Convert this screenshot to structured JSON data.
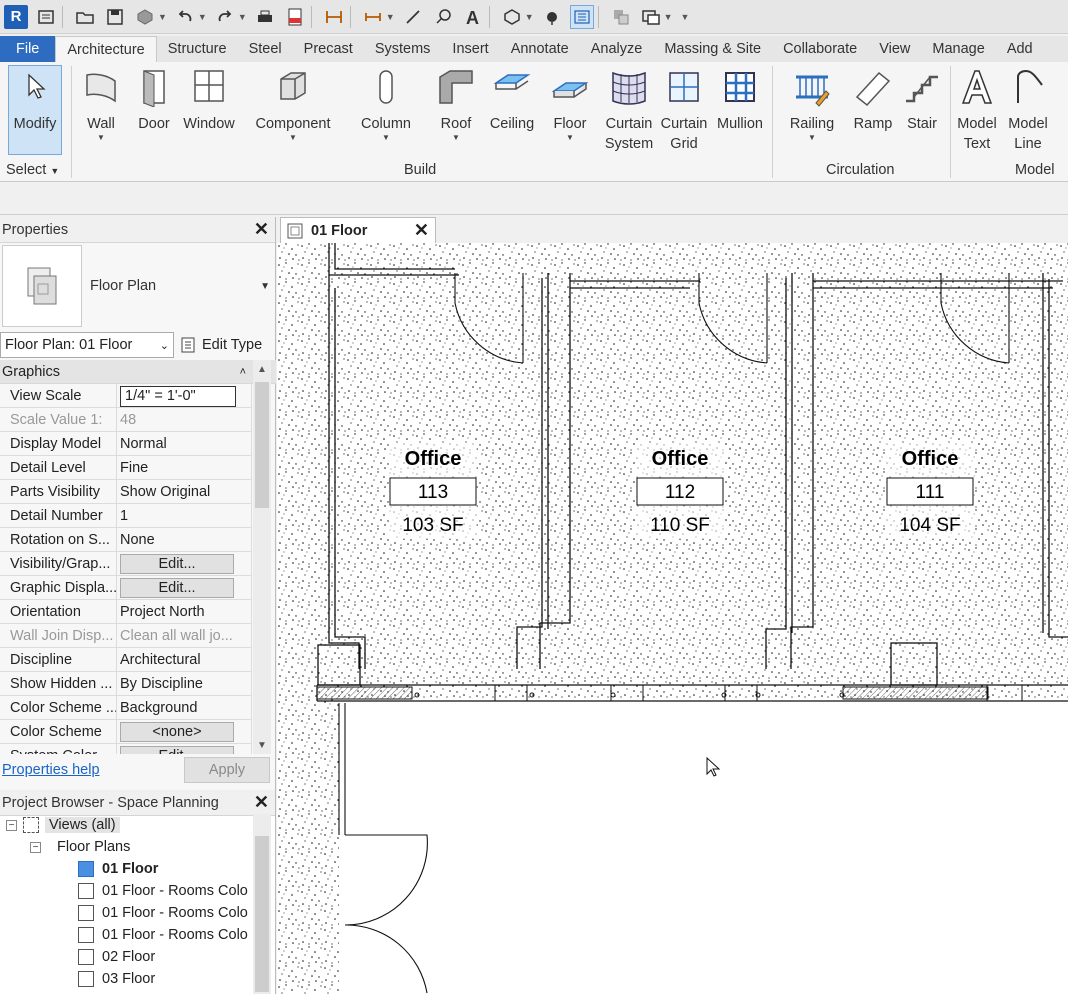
{
  "app": {
    "logo_letter": "R"
  },
  "quick_access": {
    "icons": [
      "home-icon",
      "open-icon",
      "save-icon",
      "sync-icon",
      "undo-icon",
      "redo-icon",
      "print-icon",
      "pdf-icon",
      "measure-icon",
      "dimension-icon",
      "text-icon",
      "3d-view-icon",
      "section-icon",
      "thin-lines-icon",
      "close-hidden-icon",
      "switch-windows-icon"
    ]
  },
  "ribbon_tabs": [
    "File",
    "Architecture",
    "Structure",
    "Steel",
    "Precast",
    "Systems",
    "Insert",
    "Annotate",
    "Analyze",
    "Massing & Site",
    "Collaborate",
    "View",
    "Manage",
    "Add"
  ],
  "active_tab": "Architecture",
  "ribbon": {
    "modify": "Modify",
    "select_label": "Select",
    "buttons": {
      "wall": "Wall",
      "door": "Door",
      "window": "Window",
      "component": "Component",
      "column": "Column",
      "roof": "Roof",
      "ceiling": "Ceiling",
      "floor": "Floor",
      "curtain_system_1": "Curtain",
      "curtain_system_2": "System",
      "curtain_grid_1": "Curtain",
      "curtain_grid_2": "Grid",
      "mullion": "Mullion",
      "railing": "Railing",
      "ramp": "Ramp",
      "stair": "Stair",
      "model_text_1": "Model",
      "model_text_2": "Text",
      "model_line_1": "Model",
      "model_line_2": "Line"
    },
    "panels": {
      "build": "Build",
      "circulation": "Circulation",
      "model": "Model"
    }
  },
  "properties": {
    "title": "Properties",
    "type_name": "Floor Plan",
    "instance_selector": "Floor Plan: 01 Floor",
    "edit_type": "Edit Type",
    "group": "Graphics",
    "rows": [
      {
        "name": "View Scale",
        "value": "1/4\" = 1'-0\"",
        "style": "boxed"
      },
      {
        "name": "Scale Value    1:",
        "value": "48",
        "style": "gray"
      },
      {
        "name": "Display Model",
        "value": "Normal",
        "style": ""
      },
      {
        "name": "Detail Level",
        "value": "Fine",
        "style": ""
      },
      {
        "name": "Parts Visibility",
        "value": "Show Original",
        "style": ""
      },
      {
        "name": "Detail Number",
        "value": "1",
        "style": ""
      },
      {
        "name": "Rotation on S...",
        "value": "None",
        "style": ""
      },
      {
        "name": "Visibility/Grap...",
        "value": "Edit...",
        "style": "button"
      },
      {
        "name": "Graphic Displa...",
        "value": "Edit...",
        "style": "button"
      },
      {
        "name": "Orientation",
        "value": "Project North",
        "style": ""
      },
      {
        "name": "Wall Join Disp...",
        "value": "Clean all wall jo...",
        "style": "gray"
      },
      {
        "name": "Discipline",
        "value": "Architectural",
        "style": ""
      },
      {
        "name": "Show Hidden ...",
        "value": "By Discipline",
        "style": ""
      },
      {
        "name": "Color Scheme ...",
        "value": "Background",
        "style": ""
      },
      {
        "name": "Color Scheme",
        "value": "<none>",
        "style": "button"
      },
      {
        "name": "System Color ...",
        "value": "Edit...",
        "style": "button"
      }
    ],
    "help_link": "Properties help",
    "apply": "Apply"
  },
  "project_browser": {
    "title": "Project Browser - Space Planning",
    "nodes": [
      {
        "label": "Views (all)",
        "level": 0,
        "kind": "root"
      },
      {
        "label": "Floor Plans",
        "level": 1,
        "kind": "folder"
      },
      {
        "label": "01 Floor",
        "level": 2,
        "kind": "view-active"
      },
      {
        "label": "01 Floor - Rooms Colo",
        "level": 2,
        "kind": "view"
      },
      {
        "label": "01 Floor - Rooms Colo",
        "level": 2,
        "kind": "view"
      },
      {
        "label": "01 Floor - Rooms Colo",
        "level": 2,
        "kind": "view"
      },
      {
        "label": "02 Floor",
        "level": 2,
        "kind": "view"
      },
      {
        "label": "03 Floor",
        "level": 2,
        "kind": "view"
      }
    ]
  },
  "view_tab": {
    "label": "01 Floor"
  },
  "rooms": [
    {
      "name": "Office",
      "number": "113",
      "area": "103 SF"
    },
    {
      "name": "Office",
      "number": "112",
      "area": "110 SF"
    },
    {
      "name": "Office",
      "number": "111",
      "area": "104 SF"
    }
  ]
}
